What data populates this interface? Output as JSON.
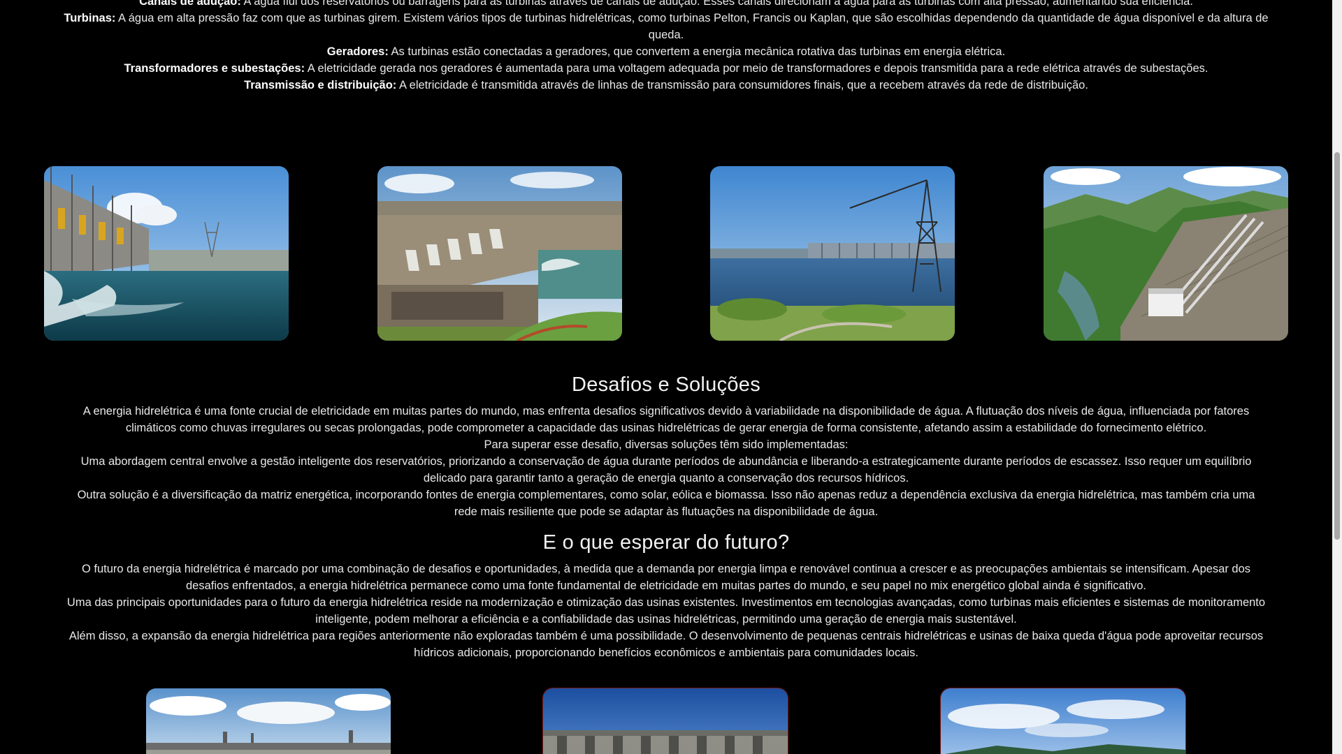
{
  "intro": {
    "items": [
      {
        "term": "Canais de adução:",
        "text": " A água flui dos reservatórios ou barragens para as turbinas através de canais de adução. Esses canais direcionam a água para as turbinas com alta pressão, aumentando sua eficiência."
      },
      {
        "term": "Turbinas:",
        "text": " A água em alta pressão faz com que as turbinas girem. Existem vários tipos de turbinas hidrelétricas, como turbinas Pelton, Francis ou Kaplan, que são escolhidas dependendo da quantidade de água disponível e da altura de queda."
      },
      {
        "term": "Geradores:",
        "text": " As turbinas estão conectadas a geradores, que convertem a energia mecânica rotativa das turbinas em energia elétrica."
      },
      {
        "term": "Transformadores e subestações:",
        "text": " A eletricidade gerada nos geradores é aumentada para uma voltagem adequada por meio de transformadores e depois transmitida para a rede elétrica através de subestações."
      },
      {
        "term": "Transmissão e distribuição:",
        "text": " A eletricidade é transmitida através de linhas de transmissão para consumidores finais, que a recebem através da rede de distribuição."
      }
    ]
  },
  "challenges": {
    "title": "Desafios e Soluções",
    "paragraphs": [
      "A energia hidrelétrica é uma fonte crucial de eletricidade em muitas partes do mundo, mas enfrenta desafios significativos devido à variabilidade na disponibilidade de água. A flutuação dos níveis de água, influenciada por fatores climáticos como chuvas irregulares ou secas prolongadas, pode comprometer a capacidade das usinas hidrelétricas de gerar energia de forma consistente, afetando assim a estabilidade do fornecimento elétrico.",
      "Para superar esse desafio, diversas soluções têm sido implementadas:",
      "Uma abordagem central envolve a gestão inteligente dos reservatórios, priorizando a conservação de água durante períodos de abundância e liberando-a estrategicamente durante períodos de escassez. Isso requer um equilíbrio delicado para garantir tanto a geração de energia quanto a conservação dos recursos hídricos.",
      "Outra solução é a diversificação da matriz energética, incorporando fontes de energia complementares, como solar, eólica e biomassa. Isso não apenas reduz a dependência exclusiva da energia hidrelétrica, mas também cria uma rede mais resiliente que pode se adaptar às flutuações na disponibilidade de água."
    ]
  },
  "future": {
    "title": "E o que esperar do futuro?",
    "paragraphs": [
      "O futuro da energia hidrelétrica é marcado por uma combinação de desafios e oportunidades, à medida que a demanda por energia limpa e renovável continua a crescer e as preocupações ambientais se intensificam. Apesar dos desafios enfrentados, a energia hidrelétrica permanece como uma fonte fundamental de eletricidade em muitas partes do mundo, e seu papel no mix energético global ainda é significativo.",
      "Uma das principais oportunidades para o futuro da energia hidrelétrica reside na modernização e otimização das usinas existentes. Investimentos em tecnologias avançadas, como turbinas mais eficientes e sistemas de monitoramento inteligente, podem melhorar a eficiência e a confiabilidade das usinas hidrelétricas, permitindo uma geração de energia mais sustentável.",
      "Além disso, a expansão da energia hidrelétrica para regiões anteriormente não exploradas também é uma possibilidade. O desenvolvimento de pequenas centrais hidrelétricas e usinas de baixa queda d'água pode aproveitar recursos hídricos adicionais, proporcionando benefícios econômicos e ambientais para comunidades locais."
    ]
  },
  "colors": {
    "background": "#000000",
    "text": "#e8e8e8",
    "heading": "#f2f2f2"
  }
}
